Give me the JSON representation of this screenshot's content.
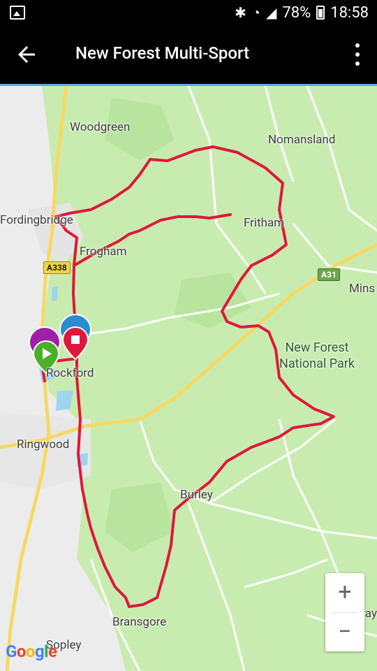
{
  "status_bar": {
    "battery": "78%",
    "time": "18:58",
    "icons": [
      "gallery-icon",
      "bluetooth-icon",
      "wifi-icon",
      "signal-icon",
      "battery-icon"
    ]
  },
  "app_bar": {
    "title": "New Forest Multi-Sport",
    "back_icon": "arrow-back-icon",
    "menu_icon": "more-vert-icon"
  },
  "map": {
    "places": {
      "woodgreen": "Woodgreen",
      "nomansland": "Nomansland",
      "fordingbridge": "Fordingbridge",
      "fritham": "Fritham",
      "frogham": "Frogham",
      "mins": "Mins",
      "new_forest_line1": "New Forest",
      "new_forest_line2": "National Park",
      "rockford": "Rockford",
      "ringwood": "Ringwood",
      "burley": "Burley",
      "bransgore": "Bransgore",
      "sopley": "Sopley",
      "sway": "Sway"
    },
    "roads": {
      "a338": "A338",
      "a31": "A31"
    },
    "route_color": "#e0173a",
    "attribution": "Google"
  },
  "zoom": {
    "in": "+",
    "out": "−"
  }
}
